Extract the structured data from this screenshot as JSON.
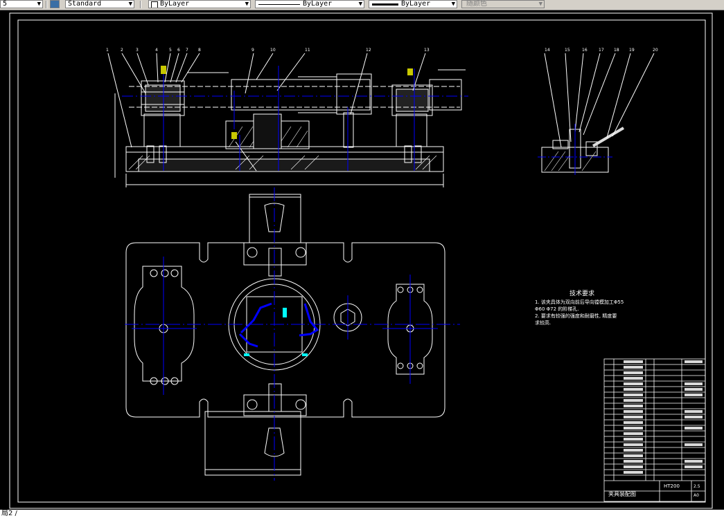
{
  "toolbar": {
    "layer_value": "5",
    "style_value": "Standard",
    "color_value": "ByLayer",
    "linetype_value": "ByLayer",
    "lineweight_value": "ByLayer",
    "plotstyle_value": "随颜色"
  },
  "drawing": {
    "tech_title": "技术要求",
    "tech_line1": "1. 该夹具体为双向前后导向镗模加工Φ55",
    "tech_line2": "Φ60  Φ72  的阶梯孔.",
    "tech_line3": "2. 要求有较强的强度和耐磨性, 精度要",
    "tech_line4": "求较高.",
    "title_block_name": "夹具装配图",
    "title_block_material": "HT200",
    "title_block_scale": "2.5",
    "title_block_sheet": "A0",
    "balloons_front": [
      "1",
      "2",
      "3",
      "4",
      "5",
      "6",
      "7",
      "8",
      "9",
      "10",
      "11",
      "12",
      "13"
    ],
    "balloons_side": [
      "14",
      "15",
      "16",
      "17",
      "18",
      "19",
      "20"
    ]
  },
  "command_line": {
    "text": "局2 /"
  },
  "colors": {
    "background": "#000000",
    "outline": "#ffffff",
    "centerline": "#0000ff",
    "accent": "#00ffff"
  }
}
